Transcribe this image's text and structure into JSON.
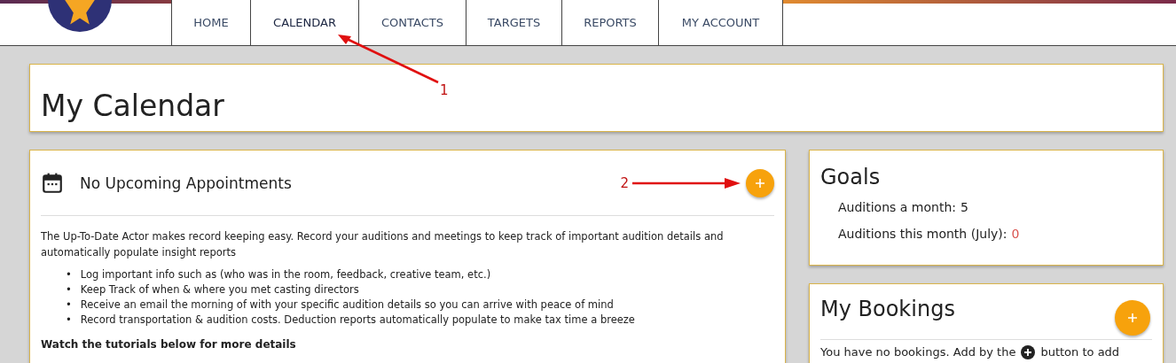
{
  "nav": {
    "items": [
      {
        "label": "HOME",
        "selected": false
      },
      {
        "label": "CALENDAR",
        "selected": true
      },
      {
        "label": "CONTACTS",
        "selected": false
      },
      {
        "label": "TARGETS",
        "selected": false
      },
      {
        "label": "REPORTS",
        "selected": false
      },
      {
        "label": "MY ACCOUNT",
        "selected": false
      }
    ]
  },
  "page_title": "My Calendar",
  "appointments": {
    "title": "No Upcoming Appointments",
    "intro": "The Up-To-Date Actor makes record keeping easy. Record your auditions and meetings to keep track of important audition details and automatically populate insight reports",
    "bullet_marker": "•",
    "bullets": [
      "Log important info such as (who was in the room, feedback, creative team, etc.)",
      "Keep Track of when & where you met casting directors",
      "Receive an email the morning of with your specific audition details so you can arrive with peace of mind",
      "Record transportation & audition costs. Deduction reports automatically populate to make tax time a breeze"
    ],
    "tutorials": "Watch the tutorials below for more details"
  },
  "goals": {
    "title": "Goals",
    "lines": [
      {
        "label": "Auditions a month:",
        "value": "5",
        "alert": false
      },
      {
        "label": "Auditions this month (July):",
        "value": "0",
        "alert": true
      }
    ]
  },
  "bookings": {
    "title": "My Bookings",
    "text_before": "You have no bookings. Add by the",
    "text_after": "button to add"
  },
  "annotations": [
    {
      "label": "1"
    },
    {
      "label": "2"
    }
  ]
}
